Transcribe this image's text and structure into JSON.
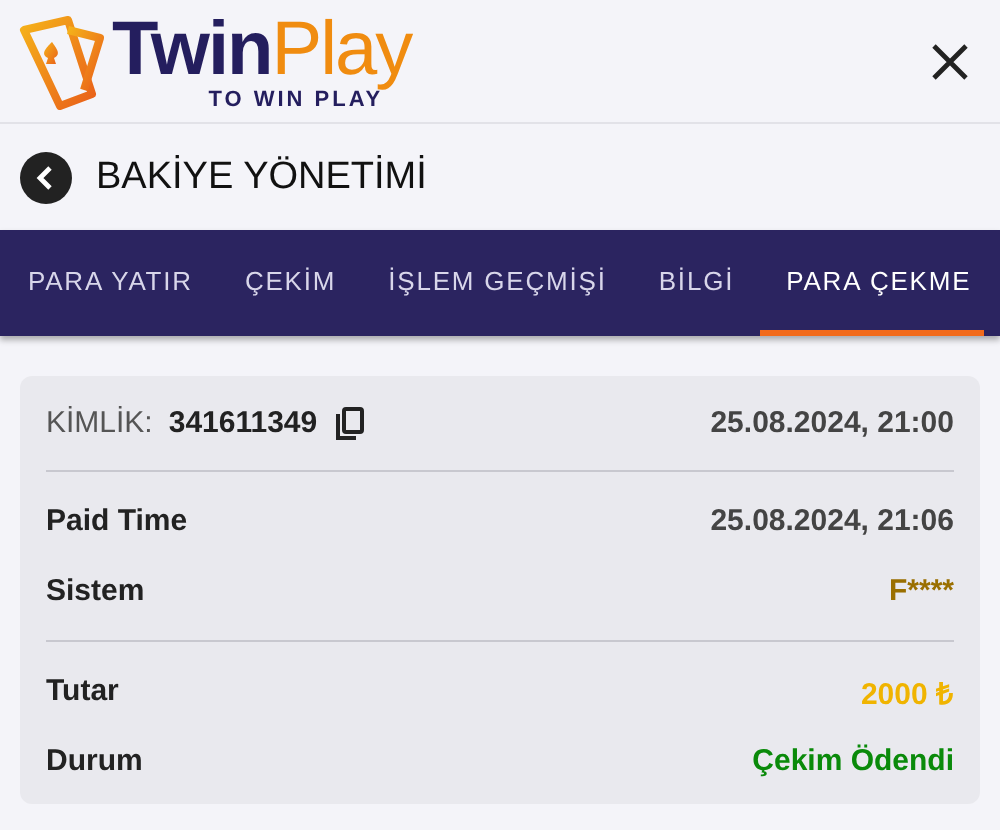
{
  "logo": {
    "name_first": "Twin",
    "name_second": "Play",
    "tagline": "TO WIN PLAY"
  },
  "page_title": "BAKİYE YÖNETİMİ",
  "tabs": [
    {
      "label": "PARA YATIR",
      "selected": false
    },
    {
      "label": "ÇEKİM",
      "selected": false
    },
    {
      "label": "İŞLEM GEÇMİŞİ",
      "selected": false
    },
    {
      "label": "BİLGİ",
      "selected": false
    },
    {
      "label": "PARA ÇEKME",
      "selected": true
    }
  ],
  "card": {
    "id_label": "KİMLİK:",
    "id_value": "341611349",
    "created": "25.08.2024, 21:00",
    "rows": [
      {
        "label": "Paid Time",
        "value": "25.08.2024, 21:06",
        "kind": "plain",
        "divider_before": false
      },
      {
        "label": "Sistem",
        "value": "F****",
        "kind": "masked",
        "divider_before": false
      },
      {
        "label": "Tutar",
        "value": "2000 ₺",
        "kind": "amount",
        "divider_before": true
      },
      {
        "label": "Durum",
        "value": "Çekim Ödendi",
        "kind": "status",
        "divider_before": false
      }
    ]
  }
}
